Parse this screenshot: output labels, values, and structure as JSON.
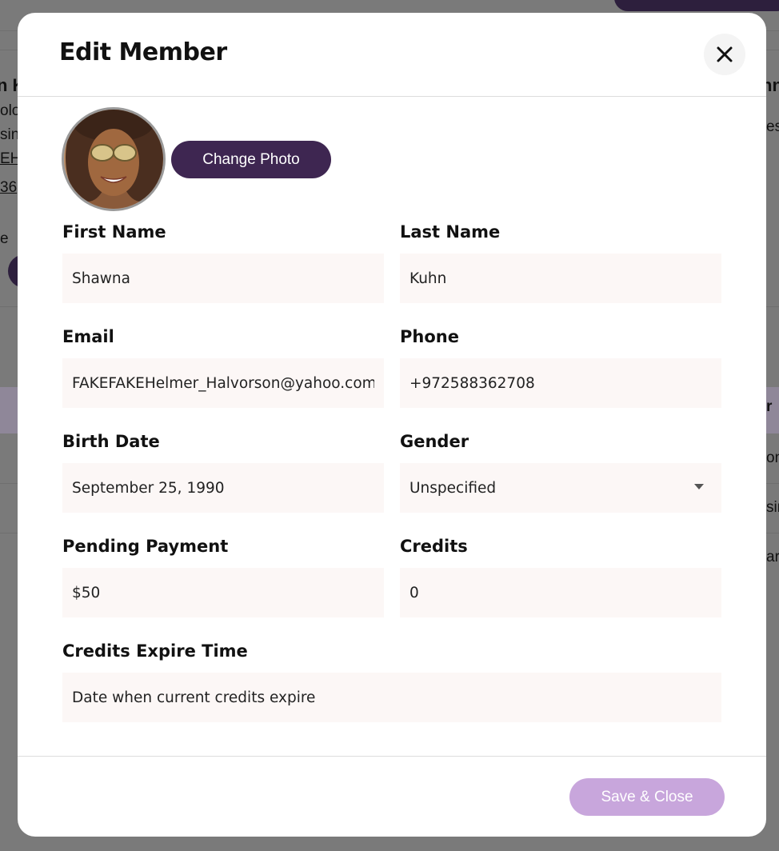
{
  "background": {
    "left_fragments": [
      "n K",
      "olo",
      "sin",
      "EH",
      "36",
      "e"
    ],
    "right_fragments": [
      "nn",
      "es",
      "r",
      "on",
      "sin",
      "ar"
    ]
  },
  "modal": {
    "title": "Edit Member",
    "close_icon": "close-icon",
    "change_photo_label": "Change Photo",
    "fields": {
      "first_name": {
        "label": "First Name",
        "value": "Shawna"
      },
      "last_name": {
        "label": "Last Name",
        "value": "Kuhn"
      },
      "email": {
        "label": "Email",
        "value": "FAKEFAKEHelmer_Halvorson@yahoo.com"
      },
      "phone": {
        "label": "Phone",
        "value": "+972588362708"
      },
      "birth_date": {
        "label": "Birth Date",
        "value": "September 25, 1990"
      },
      "gender": {
        "label": "Gender",
        "value": "Unspecified"
      },
      "pending_payment": {
        "label": "Pending Payment",
        "value": "$50"
      },
      "credits": {
        "label": "Credits",
        "value": "0"
      },
      "credits_expire": {
        "label": "Credits Expire Time",
        "placeholder": "Date when current credits expire"
      }
    },
    "save_label": "Save & Close"
  },
  "colors": {
    "accent": "#3e2651",
    "save_disabled": "#c8a6dc",
    "field_bg": "#fcf7f6",
    "overlay": "#7a7a7a"
  }
}
